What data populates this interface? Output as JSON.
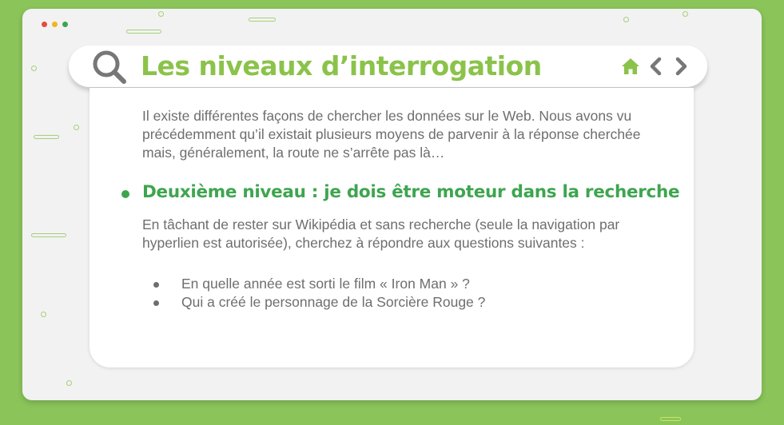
{
  "window": {
    "controls": [
      "close",
      "minimize",
      "maximize"
    ],
    "control_colors": {
      "close": "#e8493f",
      "minimize": "#f2b523",
      "maximize": "#3ea54f"
    }
  },
  "search": {
    "icon": "search-icon",
    "title": "Les niveaux d’interrogation",
    "nav": {
      "home": "home-icon",
      "back": "chevron-left-icon",
      "forward": "chevron-right-icon"
    }
  },
  "content": {
    "intro": "Il existe différentes façons de chercher les données sur le Web. Nous avons vu précédemment qu’il existait plusieurs moyens de parvenir à la réponse cherchée mais, généralement, la route ne s’arrête pas là…",
    "heading": "Deuxième niveau : je dois être moteur dans la recherche",
    "instructions": "En tâchant de rester sur Wikipédia et sans recherche (seule la navigation par hyperlien est autorisée), cherchez à répondre aux questions suivantes :",
    "questions": [
      "En quelle année est sorti le film « Iron Man » ?",
      "Qui a créé le personnage de la Sorcière Rouge ?"
    ]
  },
  "colors": {
    "background": "#8bc55a",
    "title": "#8bc34a",
    "heading": "#3ea54f",
    "body_text": "#6e6e6e",
    "icons": "#777777"
  }
}
